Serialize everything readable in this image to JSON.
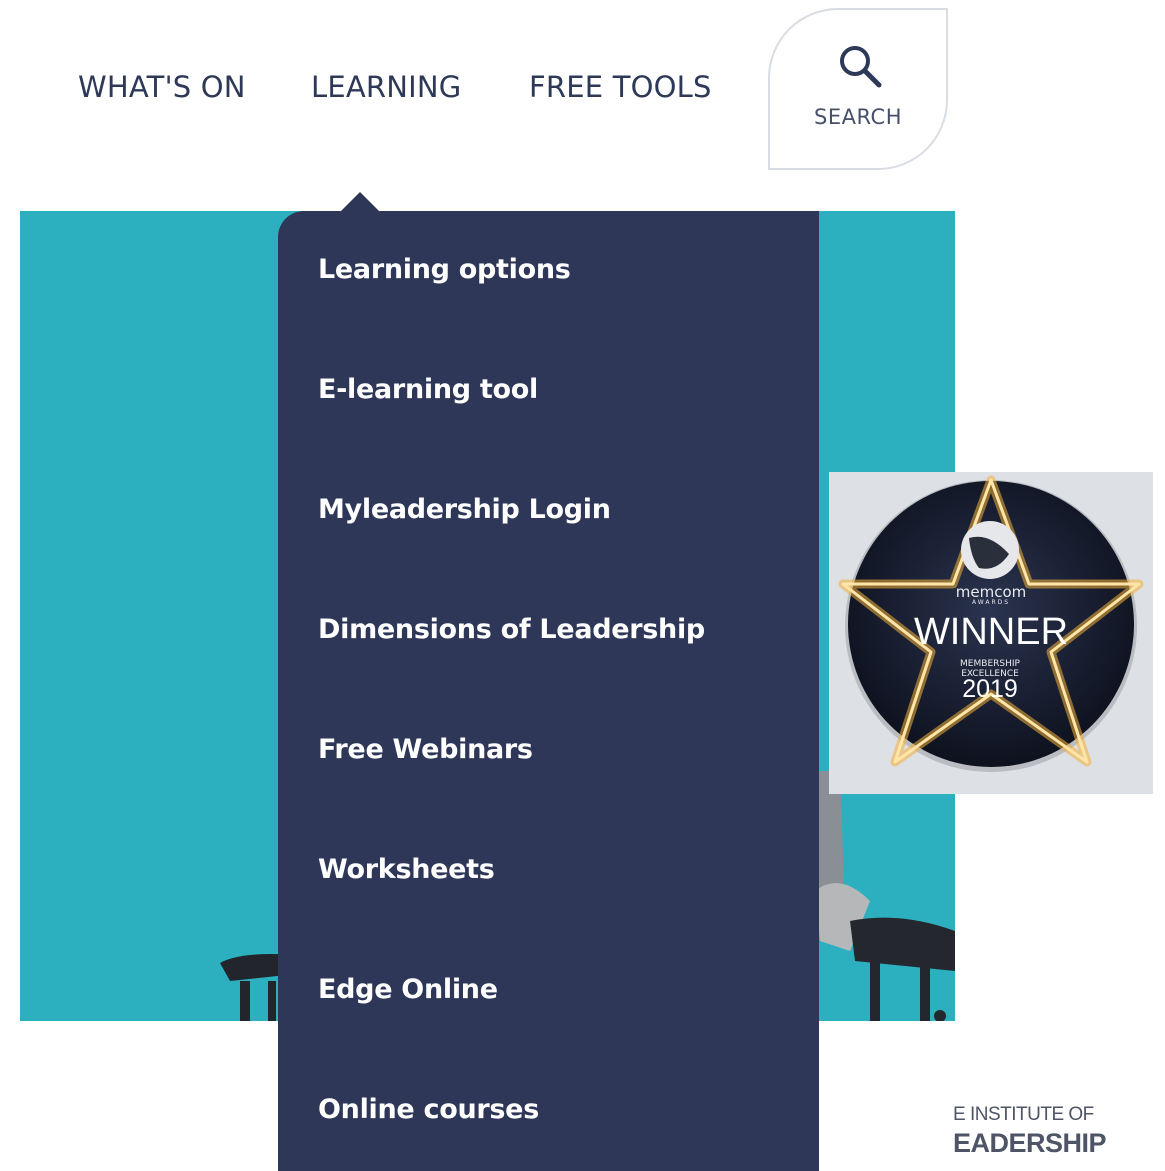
{
  "nav": {
    "items": [
      {
        "label": "WHAT'S ON"
      },
      {
        "label": "LEARNING"
      },
      {
        "label": "FREE TOOLS"
      }
    ],
    "search_label": "SEARCH"
  },
  "dropdown": {
    "items": [
      {
        "label": "Learning options"
      },
      {
        "label": "E-learning tool"
      },
      {
        "label": "Myleadership Login"
      },
      {
        "label": "Dimensions of Leadership"
      },
      {
        "label": "Free Webinars"
      },
      {
        "label": "Worksheets"
      },
      {
        "label": "Edge Online"
      },
      {
        "label": "Online courses"
      }
    ]
  },
  "badge": {
    "brand": "memcom",
    "brand_sub": "AWARDS",
    "title": "WINNER",
    "line1": "MEMBERSHIP",
    "line2": "EXCELLENCE",
    "year": "2019"
  },
  "footer": {
    "line1": "E INSTITUTE OF",
    "line2": "EADERSHIP"
  },
  "colors": {
    "nav_text": "#2e3958",
    "dropdown_bg": "#2e3758",
    "hero_teal": "#2cb0bf",
    "badge_glow": "#f3b13a"
  }
}
